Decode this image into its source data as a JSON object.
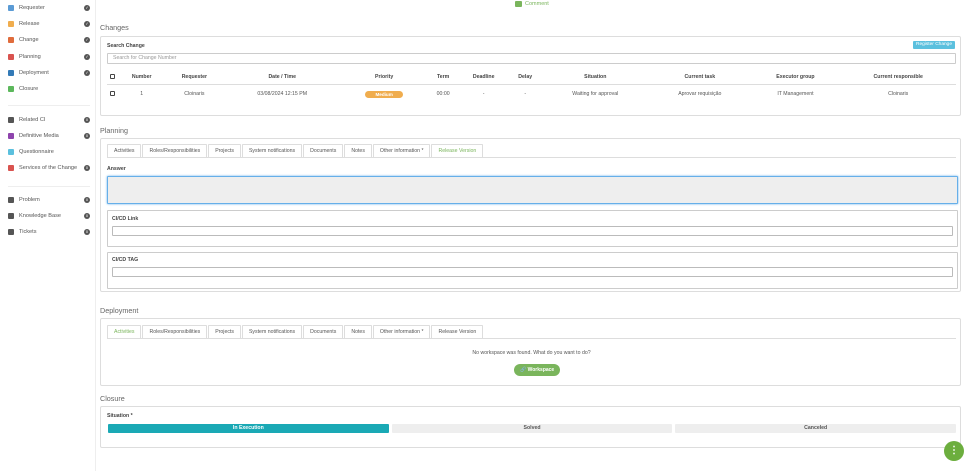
{
  "sidebar": {
    "items": [
      {
        "label": "Requester",
        "icon": "form-icon",
        "color": "#5b9bd5",
        "badge": "check"
      },
      {
        "label": "Release",
        "icon": "box-icon",
        "color": "#f0ad4e",
        "badge": "check"
      },
      {
        "label": "Change",
        "icon": "swap-icon",
        "color": "#e06c3c",
        "badge": "check"
      },
      {
        "label": "Planning",
        "icon": "calendar-icon",
        "color": "#d9534f",
        "badge": "check"
      },
      {
        "label": "Deployment",
        "icon": "cloud-upload-icon",
        "color": "#337ab7",
        "badge": "check"
      },
      {
        "label": "Closure",
        "icon": "check-circle-icon",
        "color": "#5cb85c",
        "badge": ""
      }
    ],
    "extra_items": [
      {
        "label": "Related CI",
        "icon": "laptop-icon",
        "color": "#555",
        "badge": "0"
      },
      {
        "label": "Definitive Media",
        "icon": "disc-icon",
        "color": "#8e44ad",
        "badge": "0"
      },
      {
        "label": "Questionnaire",
        "icon": "list-icon",
        "color": "#5bc0de",
        "badge": ""
      },
      {
        "label": "Services of the Change",
        "icon": "warning-icon",
        "color": "#d9534f",
        "badge": "0"
      }
    ],
    "other_items": [
      {
        "label": "Problem",
        "icon": "triangle-icon",
        "color": "#555",
        "badge": "0"
      },
      {
        "label": "Knowledge Base",
        "icon": "globe-icon",
        "color": "#555",
        "badge": "0"
      },
      {
        "label": "Tickets",
        "icon": "cart-icon",
        "color": "#555",
        "badge": "0"
      }
    ]
  },
  "comment_label": "Comment",
  "changes": {
    "title": "Changes",
    "search_label": "Search Change",
    "register_button": "Register Change",
    "search_placeholder": "Search for Change Number",
    "columns": [
      "Number",
      "Requester",
      "Date / Time",
      "Priority",
      "Term",
      "Deadline",
      "Delay",
      "Situation",
      "Current task",
      "Executor group",
      "Current responsible"
    ],
    "rows": [
      {
        "number": "1",
        "requester": "Cloinaris",
        "datetime": "03/08/2024 12:15 PM",
        "priority": "Medium",
        "term": "00:00",
        "deadline": "-",
        "delay": "-",
        "situation": "Waiting for approval",
        "current_task": "Aprovar requisição",
        "executor_group": "IT Management",
        "current_responsible": "Cloinaris"
      }
    ]
  },
  "planning": {
    "title": "Planning",
    "tabs": [
      "Activities",
      "Roles/Responsibilities",
      "Projects",
      "System notifications",
      "Documents",
      "Notes",
      "Other information *",
      "Release Version"
    ],
    "active_tab": 7,
    "answer_label": "Answer",
    "cicd_link_label": "CI/CD Link",
    "cicd_tag_label": "CI/CD TAG"
  },
  "deployment": {
    "title": "Deployment",
    "tabs": [
      "Activities",
      "Roles/Responsibilities",
      "Projects",
      "System notifications",
      "Documents",
      "Notes",
      "Other information *",
      "Release Version"
    ],
    "active_tab": 0,
    "empty_message": "No workspace was found. What do you want to do?",
    "workspace_button": "Workspace"
  },
  "closure": {
    "title": "Closure",
    "situation_label": "Situation *",
    "steps": [
      "In Execution",
      "Solved",
      "Canceled"
    ],
    "active_step": 0
  },
  "fab_label": "⋮"
}
